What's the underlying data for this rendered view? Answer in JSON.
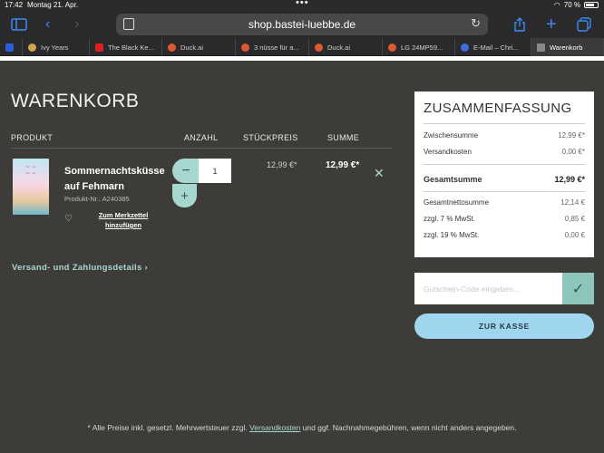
{
  "status": {
    "time": "17:42",
    "date": "Montag 21. Apr.",
    "battery": "70 %"
  },
  "browser": {
    "url": "shop.bastei-luebbe.de",
    "tabs": [
      {
        "label": "",
        "color": "#2b5fd9"
      },
      {
        "label": "Ivy Years",
        "color": "#d4a44a"
      },
      {
        "label": "The Black Ke...",
        "color": "#e02020"
      },
      {
        "label": "Duck.ai",
        "color": "#de5833"
      },
      {
        "label": "3 nüsse für a...",
        "color": "#de5833"
      },
      {
        "label": "Duck.ai",
        "color": "#de5833"
      },
      {
        "label": "LG 24MP59...",
        "color": "#de5833"
      },
      {
        "label": "E-Mail – Chri...",
        "color": "#3d6fe0"
      },
      {
        "label": "Warenkorb",
        "color": "#888888"
      }
    ]
  },
  "cart": {
    "title": "WARENKORB",
    "headers": {
      "product": "PRODUKT",
      "quantity": "ANZAHL",
      "unit_price": "STÜCKPREIS",
      "sum": "SUMME"
    },
    "item": {
      "name": "Sommernachtsküsse auf Fehmarn",
      "product_number": "Produkt-Nr.: A240385",
      "wishlist": "Zum Merkzettel hinzufügen",
      "quantity": "1",
      "unit_price": "12,99 €*",
      "sum": "12,99 €*"
    },
    "shipping_link": "Versand- und Zahlungsdetails"
  },
  "summary": {
    "title": "ZUSAMMENFASSUNG",
    "subtotal_label": "Zwischensumme",
    "subtotal": "12,99 €*",
    "shipping_label": "Versandkosten",
    "shipping": "0,00 €*",
    "total_label": "Gesamtsumme",
    "total": "12,99 €*",
    "net_label": "Gesamtnettosumme",
    "net": "12,14 €",
    "vat7_label": "zzgl. 7 % MwSt.",
    "vat7": "0,85 €",
    "vat19_label": "zzgl. 19 % MwSt.",
    "vat19": "0,00 €",
    "voucher_placeholder": "Gutschein-Code eingeben...",
    "checkout": "ZUR KASSE"
  },
  "footer": {
    "pre": "* Alle Preise inkl. gesetzl. Mehrwertsteuer zzgl. ",
    "link": "Versandkosten",
    "post": " und ggf. Nachnahmegebühren, wenn nicht anders angegeben."
  }
}
